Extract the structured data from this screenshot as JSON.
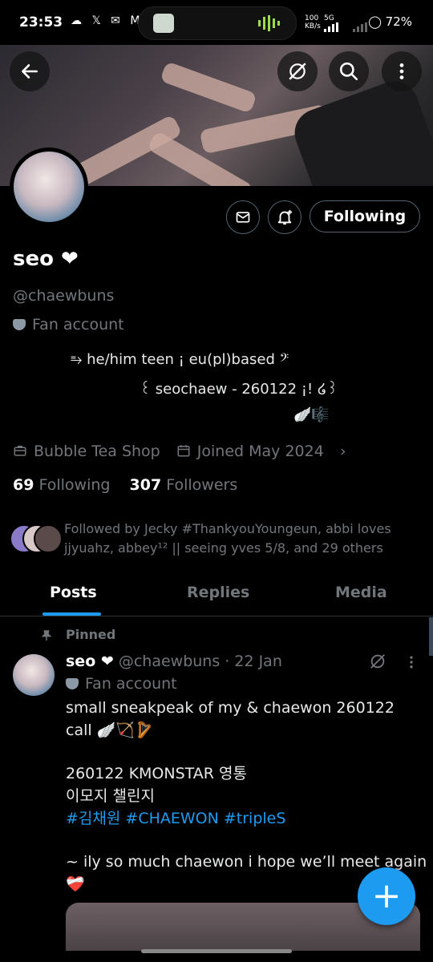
{
  "status_bar": {
    "time": "23:53",
    "notif_icons": "☁ 𝕏 ✉ M",
    "net_speed": "100\nKB/s",
    "net_type": "5G",
    "battery": "72%"
  },
  "header": {
    "back_icon": "arrow-left-icon",
    "grok_icon": "grok-icon",
    "search_icon": "search-icon",
    "more_icon": "more-vertical-icon"
  },
  "profile": {
    "name": "seo ❤",
    "handle": "@chaewbuns",
    "label": "Fan account",
    "bio_lines": [
      "⥱ he/him teen ¡ eu(pl)based 𝄢",
      "꒰ seochaew - 260122 ¡! ໒꒱",
      "🪽🎼"
    ],
    "category": "Bubble Tea Shop",
    "joined": "Joined May 2024",
    "following_count": "69",
    "following_label": "Following",
    "followers_count": "307",
    "followers_label": "Followers",
    "followed_by": "Followed by Jecky #ThankyouYoungeun, abbi loves jjyuahz, abbey¹² || seeing yves 5/8, and 29 others",
    "follow_button": "Following"
  },
  "tabs": [
    {
      "label": "Posts",
      "active": true
    },
    {
      "label": "Replies",
      "active": false
    },
    {
      "label": "Media",
      "active": false
    }
  ],
  "pinned_post": {
    "pinned_label": "Pinned",
    "author": "seo ❤",
    "handle_date": "@chaewbuns · 22 Jan",
    "label": "Fan account",
    "line1": "small sneakpeak of my & chaewon 260122",
    "line2": "call 🪽🏹🪉",
    "line3": "260122 KMONSTAR 영통",
    "line4": "이모지 챌린지",
    "hashtags": "#김채원 #CHAEWON #tripleS",
    "line5": "~ ily so much chaewon i hope we’ll meet again",
    "line6": "❤️‍🩹"
  },
  "fab": {
    "label": "+"
  },
  "colors": {
    "accent": "#1d9bf0",
    "bg": "#000000",
    "muted": "#71767b"
  }
}
